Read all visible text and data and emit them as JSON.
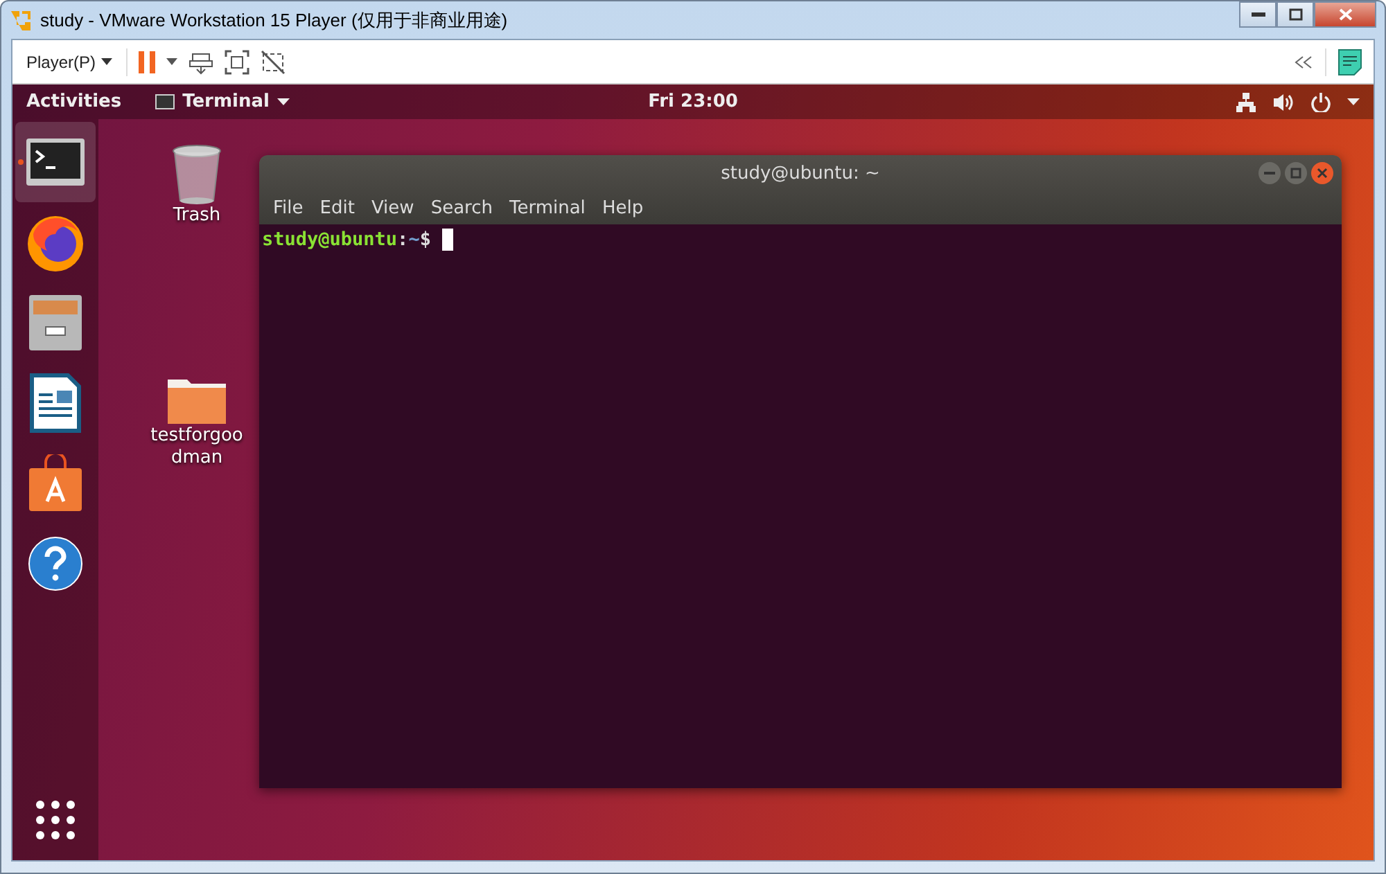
{
  "window": {
    "title": "study - VMware Workstation 15 Player (仅用于非商业用途)"
  },
  "toolbar": {
    "player_menu": "Player(P)"
  },
  "top_bar": {
    "activities": "Activities",
    "app_menu": "Terminal",
    "clock": "Fri 23:00"
  },
  "dock": [
    {
      "kind": "terminal",
      "selected": true
    },
    {
      "kind": "browser",
      "selected": false
    },
    {
      "kind": "files",
      "selected": false
    },
    {
      "kind": "writer",
      "selected": false
    },
    {
      "kind": "store",
      "selected": false
    },
    {
      "kind": "help",
      "selected": false
    }
  ],
  "desktop_icons": [
    {
      "kind": "trash",
      "label": "Trash"
    },
    {
      "kind": "folder",
      "label": "testforgoodman"
    }
  ],
  "terminal": {
    "title": "study@ubuntu: ~",
    "menu": [
      "File",
      "Edit",
      "View",
      "Search",
      "Terminal",
      "Help"
    ],
    "prompt": {
      "user_host": "study@ubuntu",
      "separator": ":",
      "path": "~",
      "symbol": "$"
    }
  }
}
